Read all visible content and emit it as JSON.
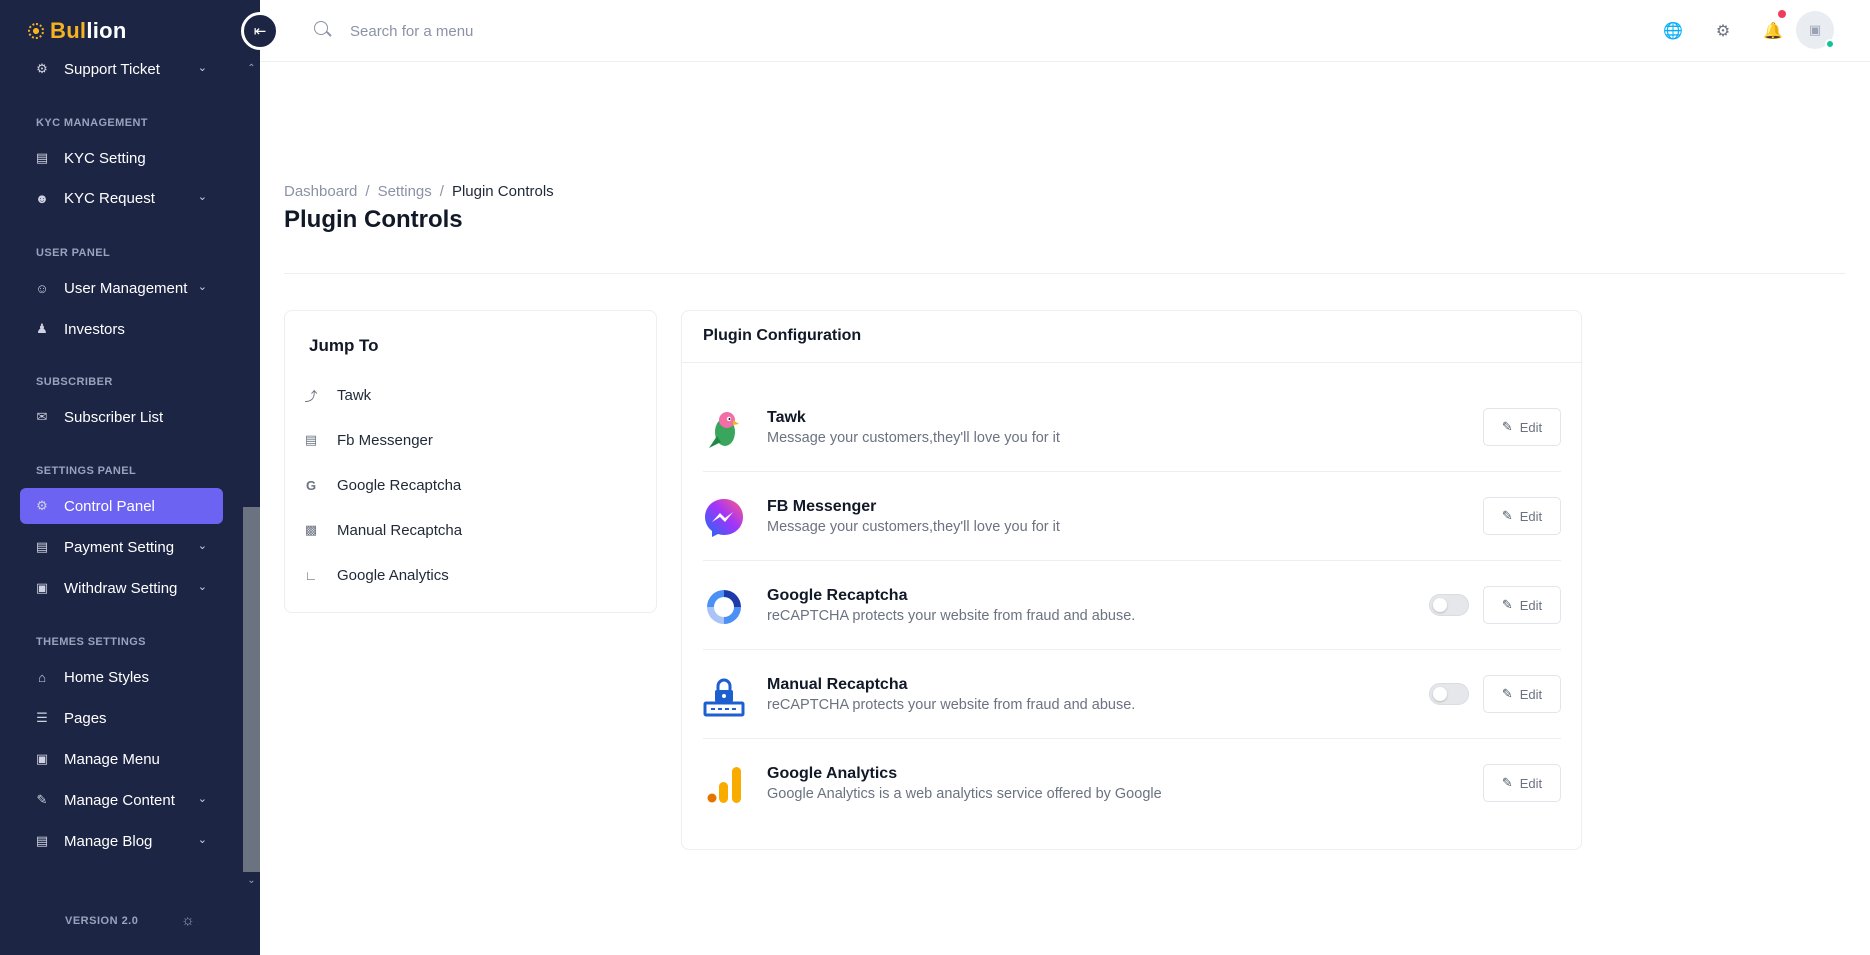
{
  "brand": {
    "name_a": "Bul",
    "name_b": "lion"
  },
  "colors": {
    "sidebar_bg": "#1c2544",
    "accent": "#6c63f2",
    "brand_gold": "#f5b320",
    "notif": "#ef3b5d",
    "online": "#10c49a"
  },
  "sidebar": {
    "support_ticket": "Support Ticket",
    "sections": {
      "kyc": "KYC MANAGEMENT",
      "user": "USER PANEL",
      "subscriber": "SUBSCRIBER",
      "settings": "SETTINGS PANEL",
      "themes": "THEMES SETTINGS"
    },
    "items": {
      "kyc_setting": "KYC Setting",
      "kyc_request": "KYC Request",
      "user_management": "User Management",
      "investors": "Investors",
      "subscriber_list": "Subscriber List",
      "control_panel": "Control Panel",
      "payment_setting": "Payment Setting",
      "withdraw_setting": "Withdraw Setting",
      "home_styles": "Home Styles",
      "pages": "Pages",
      "manage_menu": "Manage Menu",
      "manage_content": "Manage Content",
      "manage_blog": "Manage Blog"
    },
    "version": "VERSION 2.0"
  },
  "search": {
    "placeholder": "Search for a menu"
  },
  "breadcrumb": {
    "dashboard": "Dashboard",
    "settings": "Settings",
    "current": "Plugin Controls",
    "sep": "/"
  },
  "page_title": "Plugin Controls",
  "jump": {
    "title": "Jump To",
    "items": [
      "Tawk",
      "Fb Messenger",
      "Google Recaptcha",
      "Manual Recaptcha",
      "Google Analytics"
    ]
  },
  "plugins": {
    "title": "Plugin Configuration",
    "edit_label": "Edit",
    "rows": [
      {
        "name": "Tawk",
        "desc": "Message your customers,they'll love you for it",
        "toggle": false
      },
      {
        "name": "FB Messenger",
        "desc": "Message your customers,they'll love you for it",
        "toggle": false
      },
      {
        "name": "Google Recaptcha",
        "desc": "reCAPTCHA protects your website from fraud and abuse.",
        "toggle": true
      },
      {
        "name": "Manual Recaptcha",
        "desc": "reCAPTCHA protects your website from fraud and abuse.",
        "toggle": true
      },
      {
        "name": "Google Analytics",
        "desc": "Google Analytics is a web analytics service offered by Google",
        "toggle": false
      }
    ]
  }
}
